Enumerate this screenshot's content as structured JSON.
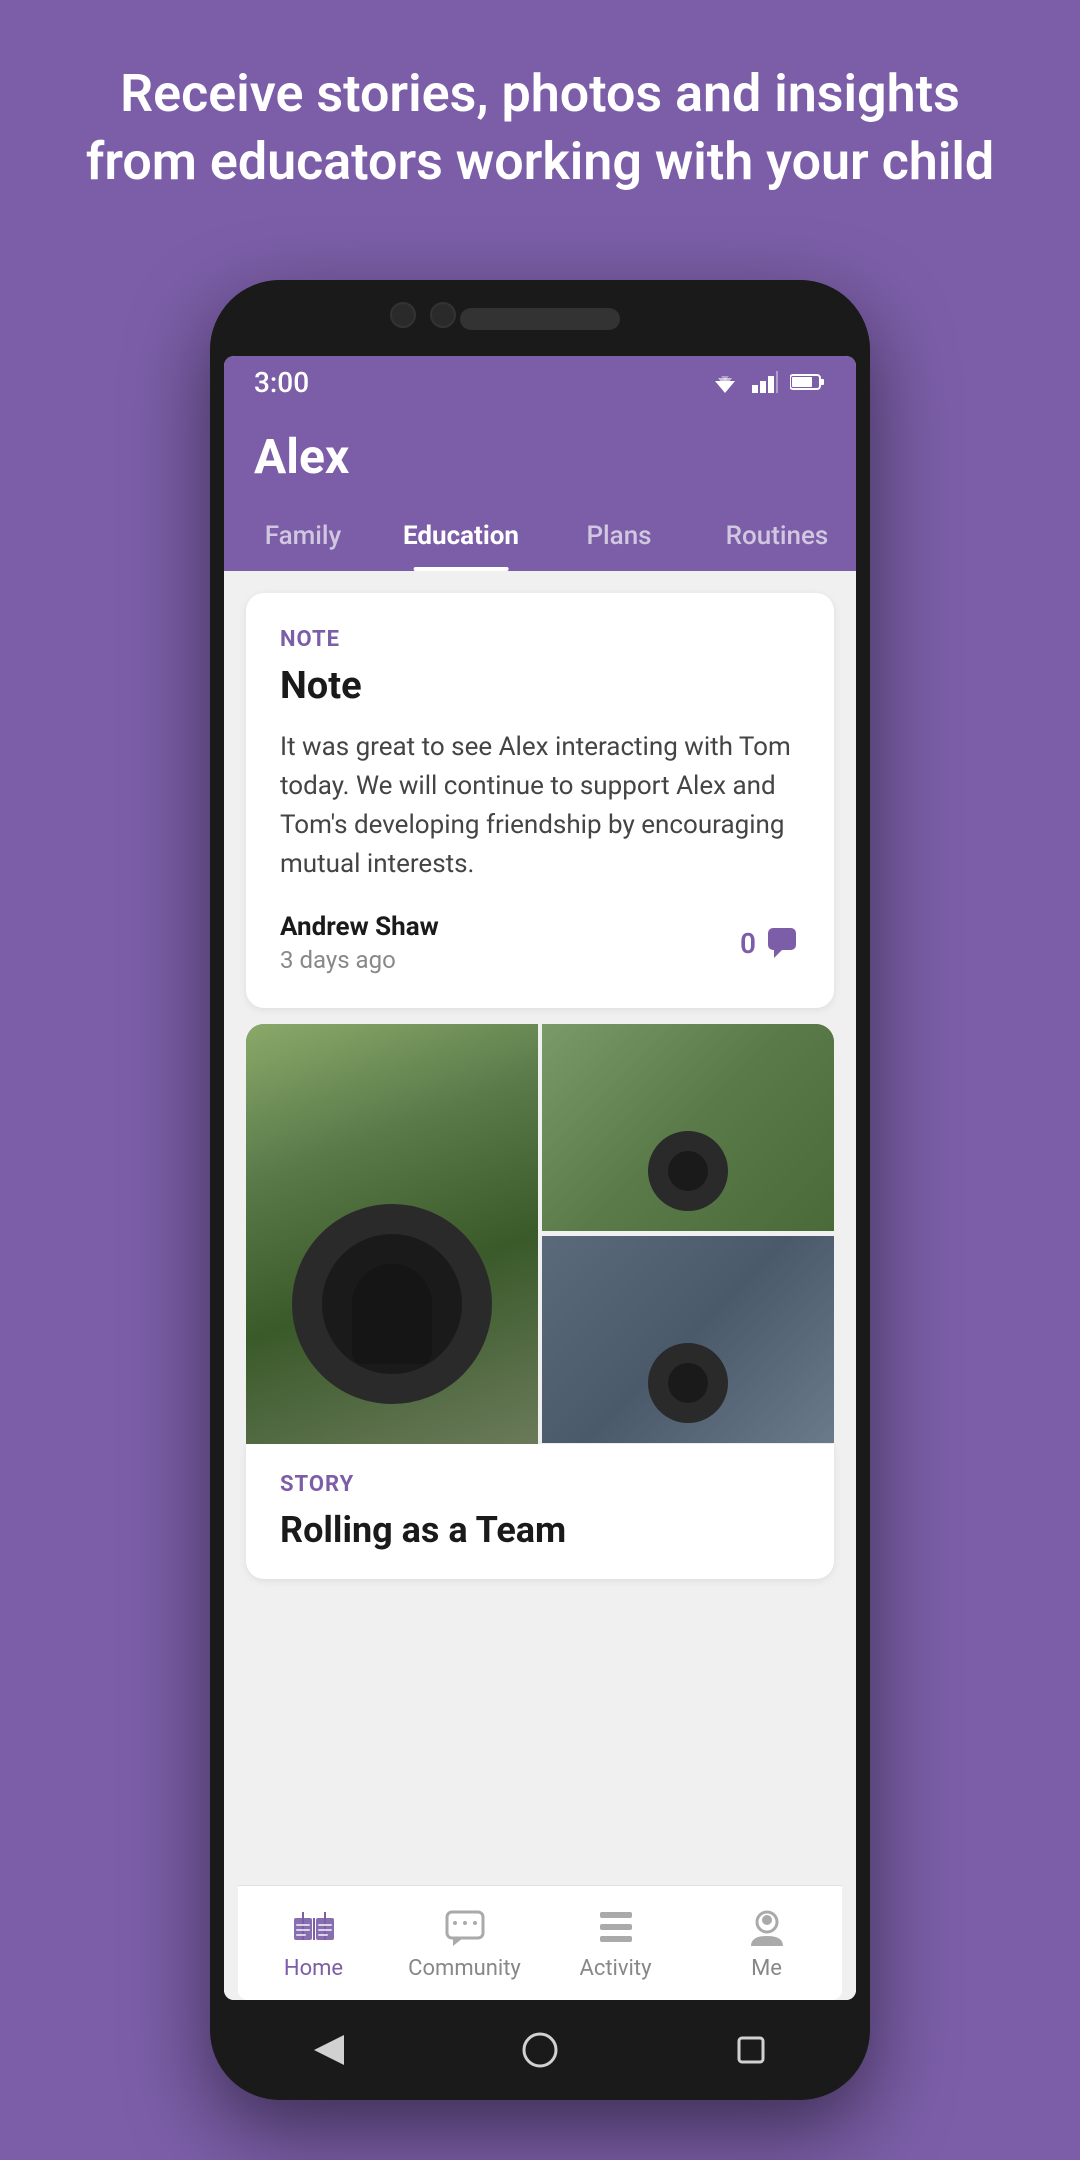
{
  "background": {
    "color": "#7B5EA7"
  },
  "header": {
    "text": "Receive stories, photos and insights from educators working with your child"
  },
  "statusBar": {
    "time": "3:00"
  },
  "appHeader": {
    "title": "Alex"
  },
  "tabs": [
    {
      "label": "Family",
      "active": false
    },
    {
      "label": "Education",
      "active": true
    },
    {
      "label": "Plans",
      "active": false
    },
    {
      "label": "Routines",
      "active": false
    }
  ],
  "noteCard": {
    "label": "NOTE",
    "title": "Note",
    "body": "It was great to see Alex interacting with Tom today. We will continue to support Alex and Tom's developing friendship by encouraging mutual interests.",
    "author": "Andrew Shaw",
    "time": "3 days ago",
    "comments": "0"
  },
  "storyCard": {
    "label": "STORY",
    "title": "Rolling as a Team"
  },
  "bottomNav": [
    {
      "label": "Home",
      "active": true,
      "icon": "home-icon"
    },
    {
      "label": "Community",
      "active": false,
      "icon": "community-icon"
    },
    {
      "label": "Activity",
      "active": false,
      "icon": "activity-icon"
    },
    {
      "label": "Me",
      "active": false,
      "icon": "me-icon"
    }
  ]
}
